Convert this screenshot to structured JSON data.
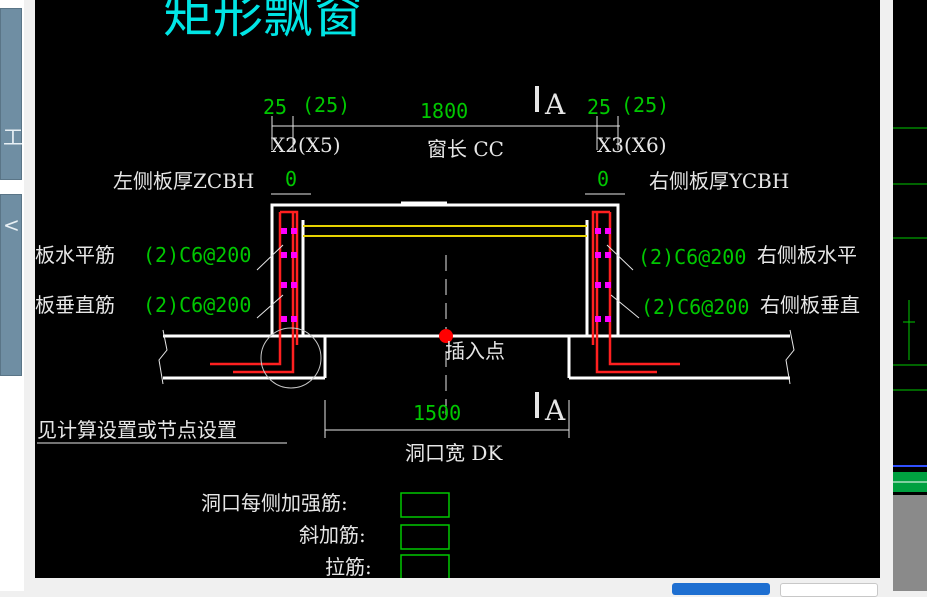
{
  "title": "矩形飘窗",
  "left_thumbs": [
    {
      "glyph": "工"
    },
    {
      "glyph": "<"
    }
  ],
  "dims": {
    "x2_val": "25",
    "x2_paren": "(25)",
    "x2_label": "X2(X5)",
    "cc_val": "1800",
    "cc_label": "窗长 CC",
    "x3_val": "25",
    "x3_paren": "(25)",
    "x3_label": "X3(X6)",
    "zcbh_label": "左侧板厚ZCBH",
    "zcbh_val": "0",
    "ycbh_label": "右侧板厚YCBH",
    "ycbh_val": "0",
    "dk_val": "1500",
    "dk_label": "洞口宽 DK",
    "section_mark": "A"
  },
  "rebar": {
    "left_h_label": "板水平筋",
    "left_h_val": "(2)C6@200",
    "left_v_label": "板垂直筋",
    "left_v_val": "(2)C6@200",
    "right_h_val": "(2)C6@200",
    "right_h_label": "右侧板水平",
    "right_v_val": "(2)C6@200",
    "right_v_label": "右侧板垂直"
  },
  "insert_point_label": "插入点",
  "calc_note": "见计算设置或节点设置",
  "fields": [
    {
      "label": "洞口每侧加强筋:",
      "value": ""
    },
    {
      "label": "斜加筋:",
      "value": ""
    },
    {
      "label": "拉筋:",
      "value": ""
    }
  ],
  "colors": {
    "title": "#00e5e5",
    "dim_value": "#00c800",
    "text": "#e6e6e6",
    "rebar": "#ff2020",
    "stirrup": "#ff00ff",
    "beam": "#e6d200",
    "insert": "#ff0000"
  }
}
